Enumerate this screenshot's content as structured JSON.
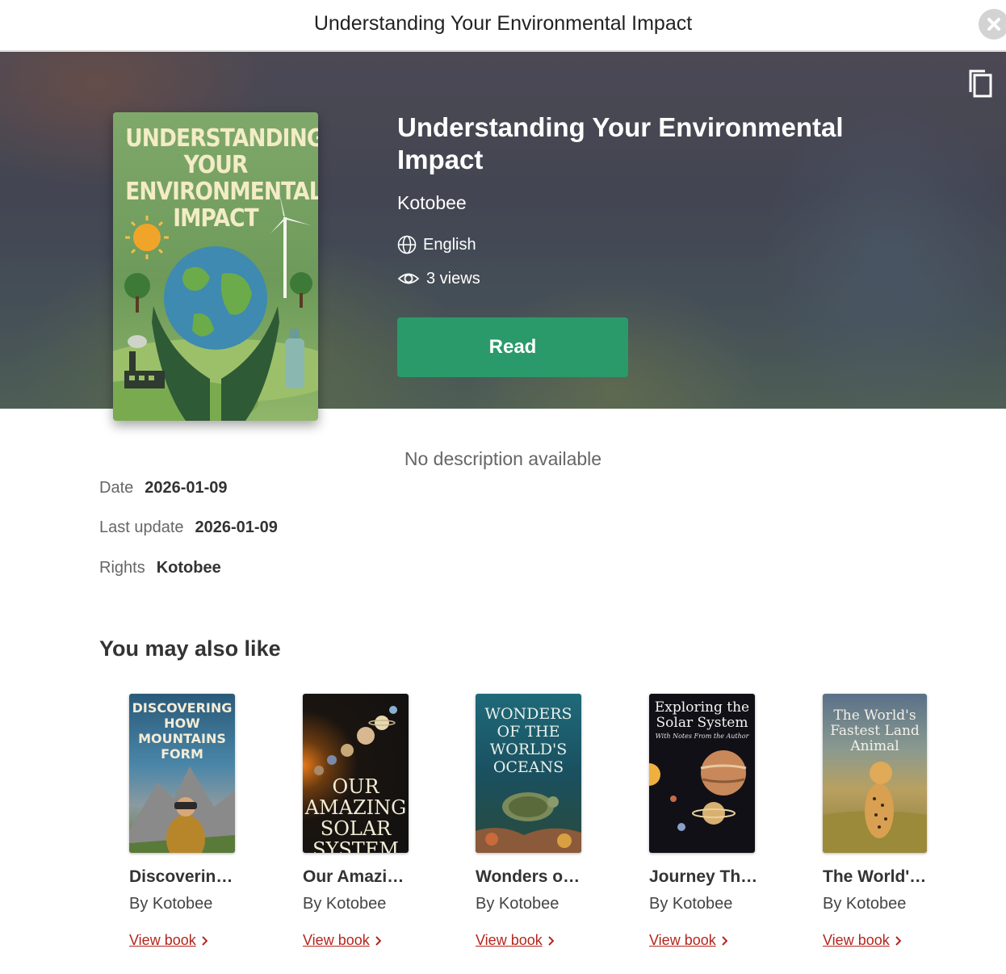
{
  "window": {
    "title": "Understanding Your Environmental Impact"
  },
  "book": {
    "cover_title": "UNDERSTANDING\nYOUR\nENVIRONMENTAL\nIMPACT",
    "title": "Understanding Your Environmental Impact",
    "author": "Kotobee",
    "language": "English",
    "views": "3 views",
    "read_label": "Read"
  },
  "description": "No description available",
  "details": [
    {
      "key": "Date",
      "value": "2026-01-09"
    },
    {
      "key": "Last update",
      "value": "2026-01-09"
    },
    {
      "key": "Rights",
      "value": "Kotobee"
    }
  ],
  "recommendations": {
    "heading": "You may also like",
    "items": [
      {
        "cover_text": "DISCOVERING\nHOW\nMOUNTAINS\nFORM",
        "title": "Discoverin…",
        "author": "By Kotobee",
        "link": "View book"
      },
      {
        "cover_text": "OUR AMAZING\nSOLAR\nSYSTEM",
        "title": "Our Amazi…",
        "author": "By Kotobee",
        "link": "View book"
      },
      {
        "cover_text": "WONDERS\nOF THE\nWORLD'S\nOCEANS",
        "title": "Wonders o…",
        "author": "By Kotobee",
        "link": "View book"
      },
      {
        "cover_text": "Exploring the\nSolar System",
        "cover_sub": "With Notes From the Author",
        "title": "Journey Th…",
        "author": "By Kotobee",
        "link": "View book"
      },
      {
        "cover_text": "The World's\nFastest Land\nAnimal",
        "title": "The World'…",
        "author": "By Kotobee",
        "link": "View book"
      }
    ]
  },
  "colors": {
    "accent": "#2a9a6a",
    "link": "#b3261e"
  },
  "icons": {
    "close": "close-icon",
    "copy": "copy-icon",
    "language": "globe-icon",
    "views": "eye-icon",
    "link": "chevron-right-icon"
  }
}
